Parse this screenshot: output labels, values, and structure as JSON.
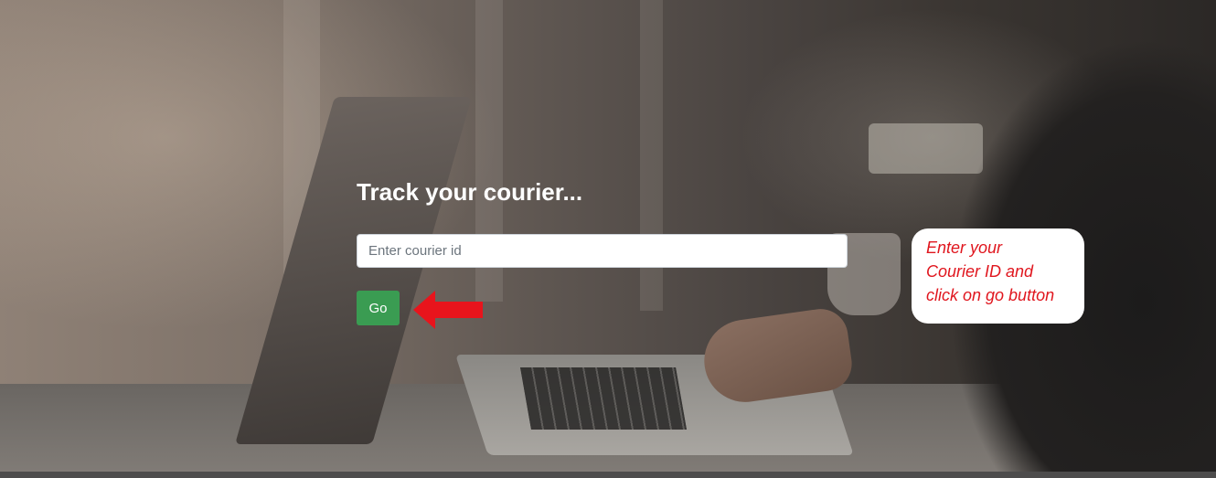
{
  "hero": {
    "title": "Track your courier...",
    "input_placeholder": "Enter courier id",
    "go_label": "Go"
  },
  "annotation": {
    "lines": [
      "Enter your",
      "Courier ID and",
      "click on go button"
    ],
    "text_color": "#e0161e",
    "arrow_color": "#e8141c",
    "arrow_icon": "left-arrow-icon"
  },
  "colors": {
    "go_button": "#3a9c52",
    "title": "#ffffff"
  }
}
